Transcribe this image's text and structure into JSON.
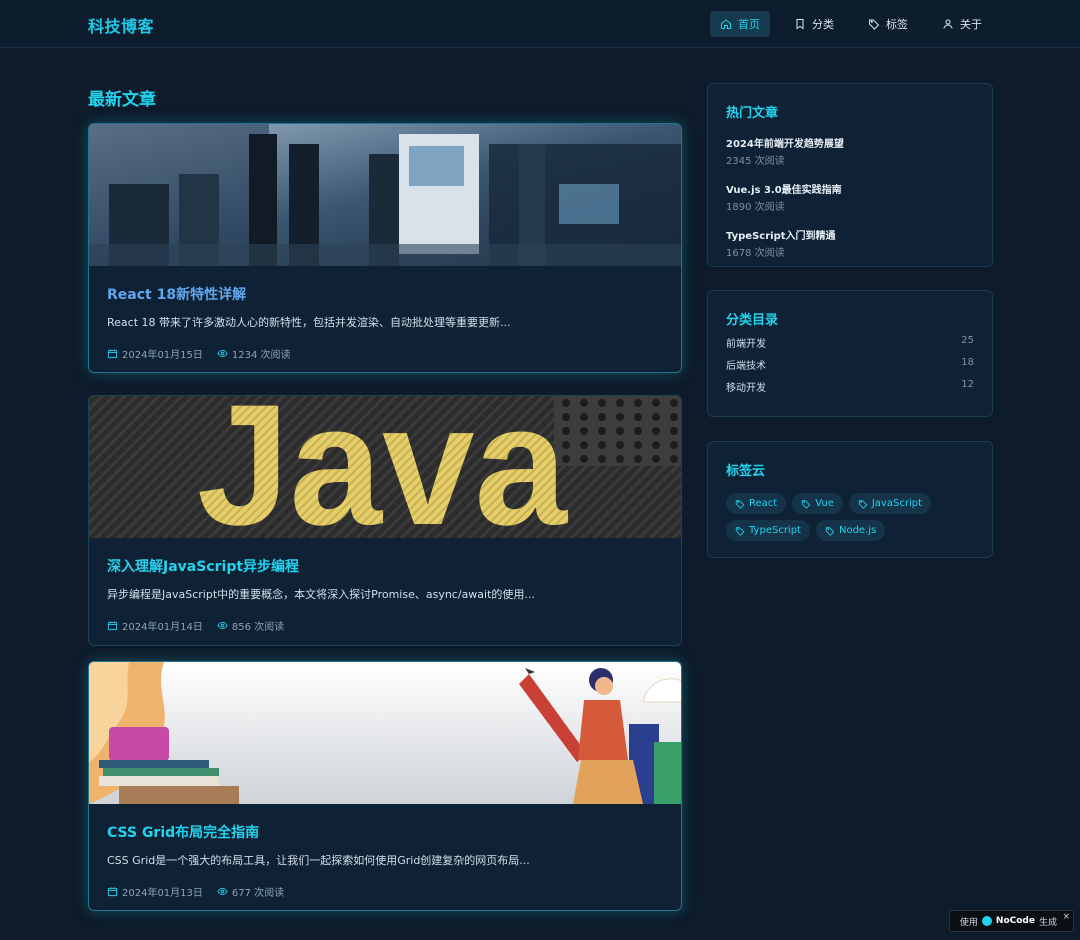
{
  "nav": {
    "brand": "科技博客",
    "items": [
      {
        "label": "首页",
        "icon": "home-icon",
        "active": true
      },
      {
        "label": "分类",
        "icon": "bookmark-icon",
        "active": false
      },
      {
        "label": "标签",
        "icon": "tag-icon",
        "active": false
      },
      {
        "label": "关于",
        "icon": "user-icon",
        "active": false
      }
    ]
  },
  "main": {
    "section_title": "最新文章",
    "articles": [
      {
        "title": "React 18新特性详解",
        "excerpt": "React 18 带来了许多激动人心的新特性，包括并发渲染、自动批处理等重要更新...",
        "date": "2024年01月15日",
        "views": "1234 次阅读",
        "image": "office-team-photo"
      },
      {
        "title": "深入理解JavaScript异步编程",
        "excerpt": "异步编程是JavaScript中的重要概念，本文将深入探讨Promise、async/await的使用...",
        "date": "2024年01月14日",
        "views": "856 次阅读",
        "image": "java-text-photo",
        "image_text": "Java"
      },
      {
        "title": "CSS Grid布局完全指南",
        "excerpt": "CSS Grid是一个强大的布局工具，让我们一起探索如何使用Grid创建复杂的网页布局...",
        "date": "2024年01月13日",
        "views": "677 次阅读",
        "image": "pencil-illustration"
      }
    ]
  },
  "sidebar": {
    "hot": {
      "title": "热门文章",
      "items": [
        {
          "title": "2024年前端开发趋势展望",
          "views": "2345 次阅读"
        },
        {
          "title": "Vue.js 3.0最佳实践指南",
          "views": "1890 次阅读"
        },
        {
          "title": "TypeScript入门到精通",
          "views": "1678 次阅读"
        }
      ]
    },
    "categories": {
      "title": "分类目录",
      "items": [
        {
          "name": "前端开发",
          "count": "25"
        },
        {
          "name": "后端技术",
          "count": "18"
        },
        {
          "name": "移动开发",
          "count": "12"
        }
      ]
    },
    "tags": {
      "title": "标签云",
      "items": [
        "React",
        "Vue",
        "JavaScript",
        "TypeScript",
        "Node.js"
      ]
    }
  },
  "badge": {
    "prefix": "使用",
    "brand": "NoCode",
    "suffix": "生成",
    "close": "×"
  },
  "colors": {
    "accent": "#22d3ee",
    "background": "#0d1b2a",
    "card": "#0f2135"
  }
}
